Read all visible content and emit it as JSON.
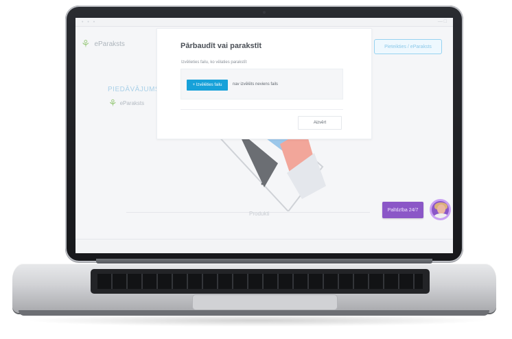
{
  "screen": {
    "logo_text": "eParaksts",
    "background_button_label": "Pieteikties / eParaksts",
    "side_title": "PIEDĀVĀJUMS",
    "side_logo_text": "eParaksts",
    "bottom_label": "Produkti",
    "chat_button_label": "Palīdzība 24/7"
  },
  "modal": {
    "title": "Pārbaudīt vai parakstīt",
    "subtitle": "Izvēlieties failu, ko vēlaties parakstīt",
    "upload_button_label": "+ Izvēlēties failu",
    "selected_file_label": "nav izvēlēts neviens fails",
    "close_button_label": "Aizvērt"
  },
  "icons": {
    "logo": "eparaksts-logo-icon",
    "avatar": "support-avatar-icon"
  },
  "colors": {
    "primary": "#17a1d9",
    "chat": "#8b57c7",
    "logo_green": "#6fb543"
  }
}
